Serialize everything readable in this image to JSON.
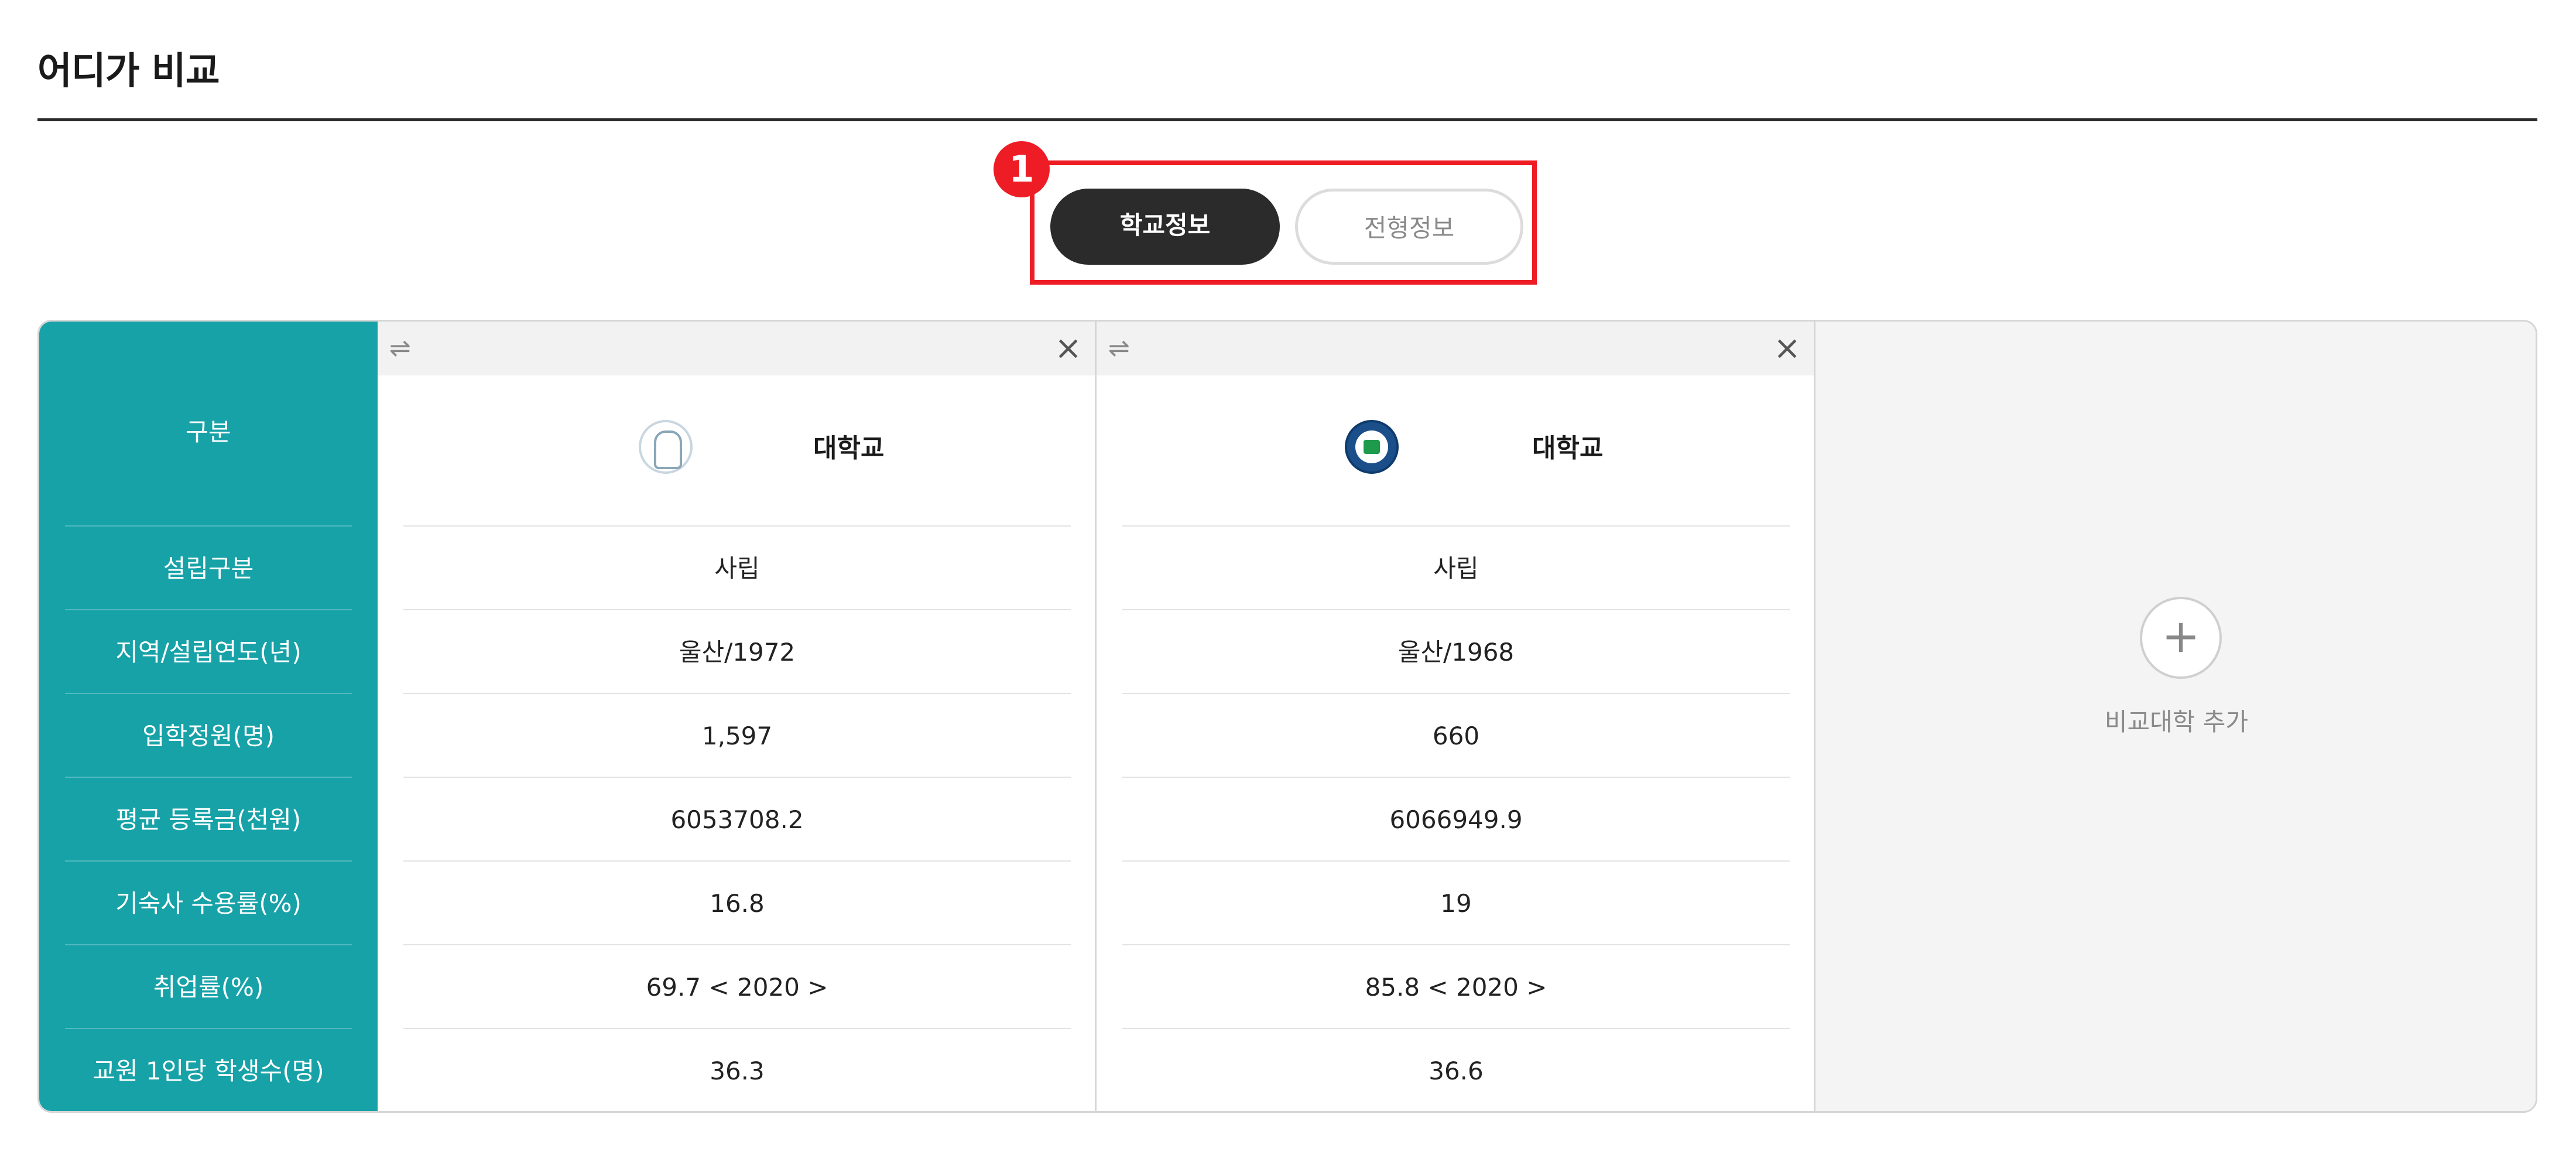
{
  "title": "어디가 비교",
  "tabs": {
    "marker": "1",
    "school_info": "학교정보",
    "admission_info": "전형정보"
  },
  "labels": {
    "category": "구분",
    "rows": [
      "설립구분",
      "지역/설립연도(년)",
      "입학정원(명)",
      "평균 등록금(천원)",
      "기숙사 수용률(%)",
      "취업률(%)",
      "교원 1인당 학생수(명)"
    ]
  },
  "icons": {
    "swap": "⇌",
    "close": "×",
    "add": "+"
  },
  "schools": [
    {
      "name": "대학교",
      "values": [
        "사립",
        "울산/1972",
        "1,597",
        "6053708.2",
        "16.8",
        "69.7 < 2020 >",
        "36.3"
      ]
    },
    {
      "name": "대학교",
      "values": [
        "사립",
        "울산/1968",
        "660",
        "6066949.9",
        "19",
        "85.8 < 2020 >",
        "36.6"
      ]
    }
  ],
  "add_school": {
    "label": "비교대학 추가"
  },
  "colors": {
    "label_column": "#17a2a8",
    "active_tab": "#2b2b2b",
    "highlight": "#ee1c25"
  }
}
